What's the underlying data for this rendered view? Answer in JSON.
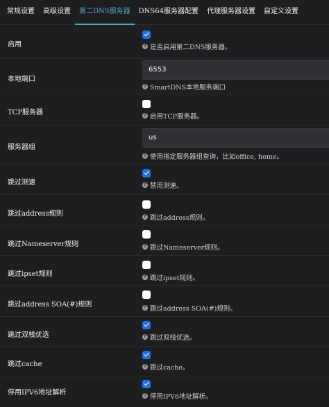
{
  "tabs": [
    {
      "label": "常规设置"
    },
    {
      "label": "高级设置"
    },
    {
      "label": "第二DNS服务器"
    },
    {
      "label": "DNS64服务器配置"
    },
    {
      "label": "代理服务器设置"
    },
    {
      "label": "自定义设置"
    }
  ],
  "rows": [
    {
      "label": "启用",
      "hint": "是否启用第二DNS服务器。"
    },
    {
      "label": "本地端口",
      "value": "6553",
      "hint": "SmartDNS本地服务端口"
    },
    {
      "label": "TCP服务器",
      "hint": "启用TCP服务器。"
    },
    {
      "label": "服务器组",
      "value": "us",
      "hint": "使用指定服务器组查询，比如office, home。"
    },
    {
      "label": "跳过测速",
      "hint": "禁用测速。"
    },
    {
      "label": "跳过address规则",
      "hint": "跳过address规则。"
    },
    {
      "label": "跳过Nameserver规则",
      "hint": "跳过Nameserver规则。"
    },
    {
      "label": "跳过ipset规则",
      "hint": "跳过ipset规则。"
    },
    {
      "label": "跳过address SOA(#)规则",
      "hint": "跳过address SOA(#)规则。"
    },
    {
      "label": "跳过双栈优选",
      "hint": "跳过双栈优选。"
    },
    {
      "label": "跳过cache",
      "hint": "跳过cache。"
    },
    {
      "label": "停用IPV6地址解析",
      "hint": "停用IPV6地址解析。"
    }
  ],
  "checks": {
    "enable": true,
    "tcp": false,
    "skip_speed": true,
    "skip_address": false,
    "skip_nameserver": false,
    "skip_ipset": false,
    "skip_soa": false,
    "skip_dualstack": true,
    "skip_cache": true,
    "disable_ipv6": true
  },
  "colors": {
    "accent": "#4aa8c4",
    "checkbox_on": "#1a73e8",
    "background": "#1e1e20"
  },
  "icons": {
    "hint": "question-circle-icon"
  }
}
